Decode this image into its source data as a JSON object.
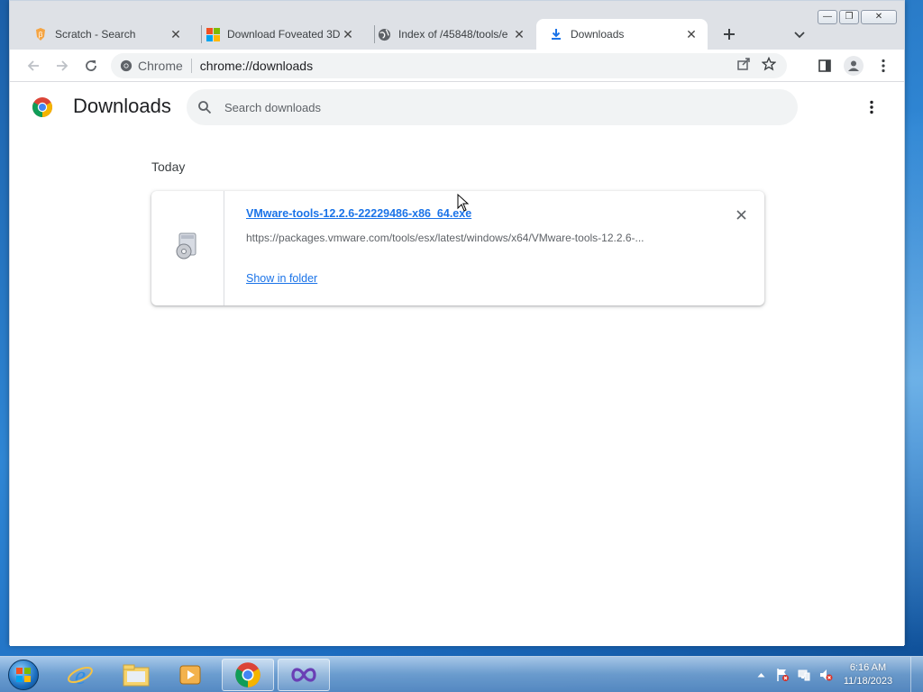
{
  "browser": {
    "tabs": [
      {
        "title": "Scratch - Search",
        "icon": "brave-search-icon",
        "active": false
      },
      {
        "title": "Download Foveated 3D",
        "icon": "microsoft-logo-icon",
        "active": false
      },
      {
        "title": "Index of /45848/tools/e",
        "icon": "globe-icon",
        "active": false
      },
      {
        "title": "Downloads",
        "icon": "download-icon",
        "active": true
      }
    ],
    "window_controls": {
      "minimize": "—",
      "maximize": "❐",
      "close": "✕"
    },
    "omnibox": {
      "chip_label": "Chrome",
      "url": "chrome://downloads"
    }
  },
  "downloads_page": {
    "title": "Downloads",
    "search_placeholder": "Search downloads",
    "section_label": "Today",
    "items": [
      {
        "file_name": "VMware-tools-12.2.6-22229486-x86_64.exe",
        "url": "https://packages.vmware.com/tools/esx/latest/windows/x64/VMware-tools-12.2.6-...",
        "action_label": "Show in folder"
      }
    ]
  },
  "taskbar": {
    "apps": [
      {
        "name": "internet-explorer-icon",
        "open": false
      },
      {
        "name": "file-explorer-icon",
        "open": false
      },
      {
        "name": "media-player-icon",
        "open": false
      },
      {
        "name": "chrome-icon",
        "open": true
      },
      {
        "name": "visual-studio-icon",
        "open": true
      }
    ],
    "clock": {
      "time": "6:16 AM",
      "date": "11/18/2023"
    }
  },
  "colors": {
    "link": "#1a73e8",
    "tabstrip": "#dee1e6",
    "omnibox": "#f1f3f4"
  }
}
